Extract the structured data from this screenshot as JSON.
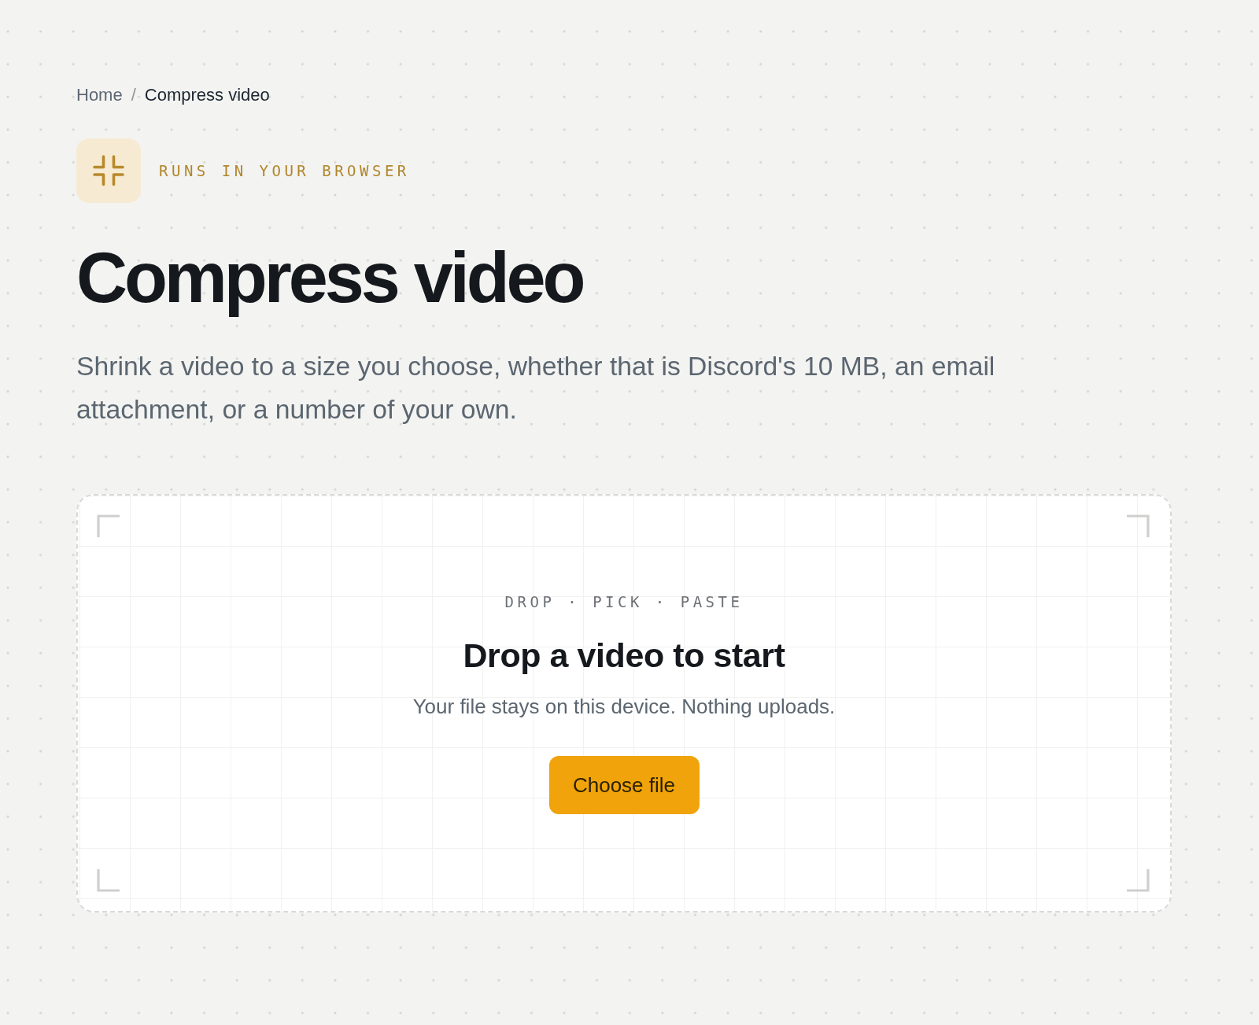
{
  "breadcrumb": {
    "items": [
      {
        "label": "Home",
        "current": false
      },
      {
        "label": "Compress video",
        "current": true
      }
    ],
    "separator": "/"
  },
  "badge": {
    "label": "RUNS IN YOUR BROWSER"
  },
  "title": "Compress video",
  "description": "Shrink a video to a size you choose, whether that is Discord's 10 MB, an email attachment, or a number of your own.",
  "dropzone": {
    "eyebrow": "DROP · PICK · PASTE",
    "heading": "Drop a video to start",
    "hint": "Your file stays on this device. Nothing uploads.",
    "button": "Choose file"
  }
}
